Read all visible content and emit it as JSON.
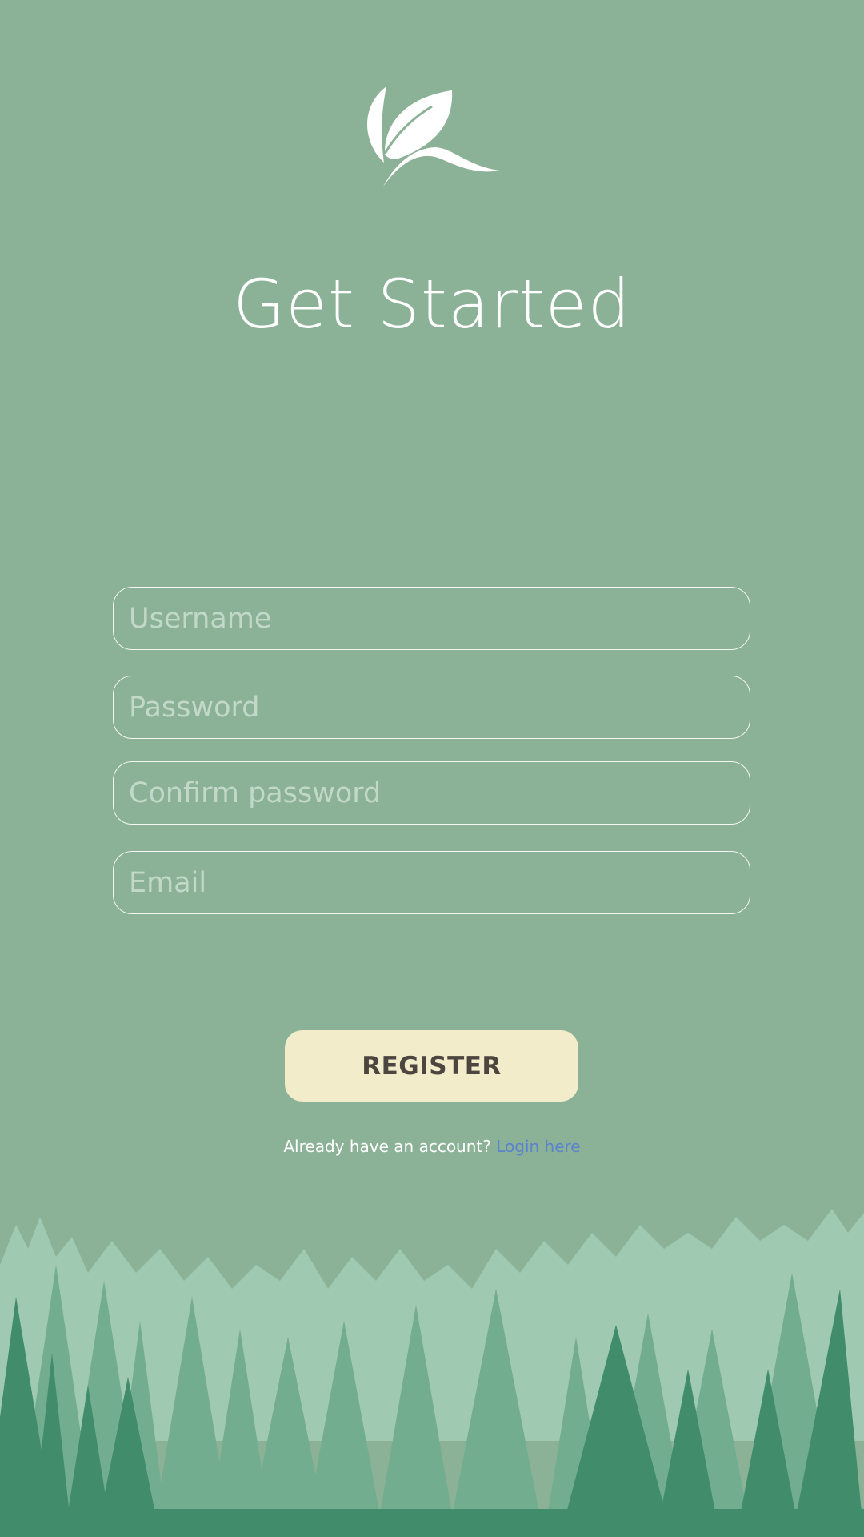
{
  "header": {
    "logo_icon": "leaf-logo-icon",
    "title": "Get Started"
  },
  "form": {
    "username_placeholder": "Username",
    "password_placeholder": "Password",
    "confirm_password_placeholder": "Confirm password",
    "email_placeholder": "Email",
    "register_label": "REGISTER"
  },
  "footer": {
    "prompt": "Already have an account?",
    "login_link": "Login here"
  },
  "colors": {
    "background": "#8bb296",
    "button": "#f3ecca",
    "button_text": "#4c4540",
    "link": "#5b82cf",
    "forest_light": "#a0c9b2",
    "forest_mid": "#72ad8f",
    "forest_dark": "#418d6b"
  },
  "decor": {
    "background_icon": "forest-silhouette-illustration"
  }
}
